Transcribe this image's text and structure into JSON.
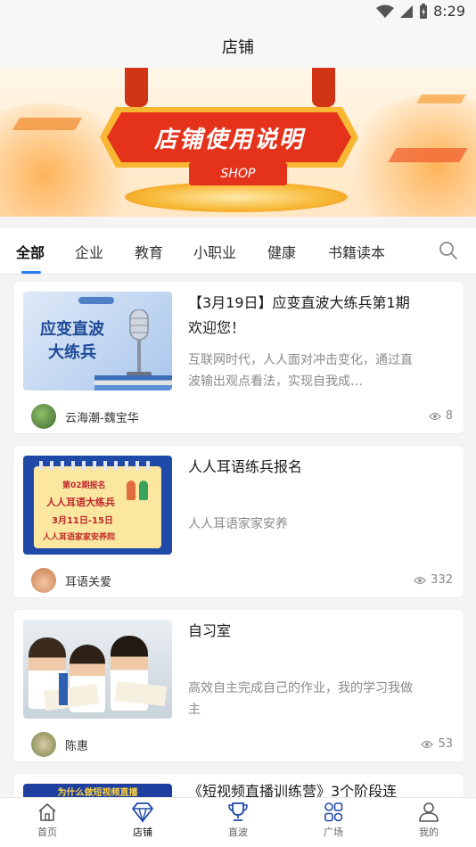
{
  "status": {
    "time": "8:29"
  },
  "header": {
    "title": "店铺"
  },
  "banner": {
    "title": "店铺使用说明",
    "subtitle": "SHOP"
  },
  "tabs": [
    {
      "label": "全部",
      "active": true
    },
    {
      "label": "企业"
    },
    {
      "label": "教育"
    },
    {
      "label": "小职业"
    },
    {
      "label": "健康"
    },
    {
      "label": "书籍读本"
    }
  ],
  "cards": [
    {
      "title": "【3月19日】应变直波大练兵第1期欢迎您！",
      "description": "互联网时代，人人面对冲击变化，通过直波输出观点看法，实现自我成…",
      "thumb_text": "应变直波\n大练兵",
      "author": "云海潮-魏宝华",
      "views": "8"
    },
    {
      "title": "人人耳语练兵报名",
      "description": "人人耳语家家安养",
      "thumb_text": "第02期报名",
      "thumb_line2": "人人耳语大练兵",
      "thumb_line3": "3月11日-15日",
      "thumb_line4": "人人耳语家家安养院",
      "author": "耳语关爱",
      "views": "332"
    },
    {
      "title": "自习室",
      "description": "高效自主完成自己的作业，我的学习我做主",
      "author": "陈惠",
      "views": "53"
    },
    {
      "title": "《短视频直播训练营》3个阶段连",
      "thumb_text": "为什么做短视频直播"
    }
  ],
  "tabbar": [
    {
      "label": "首页",
      "icon": "home-icon"
    },
    {
      "label": "店铺",
      "icon": "diamond-icon",
      "active": true
    },
    {
      "label": "直波",
      "icon": "trophy-icon"
    },
    {
      "label": "广场",
      "icon": "grid-icon"
    },
    {
      "label": "我的",
      "icon": "profile-icon"
    }
  ],
  "colors": {
    "accent": "#2a7cf6",
    "banner_red": "#e5321b",
    "banner_gold": "#f7b733"
  }
}
